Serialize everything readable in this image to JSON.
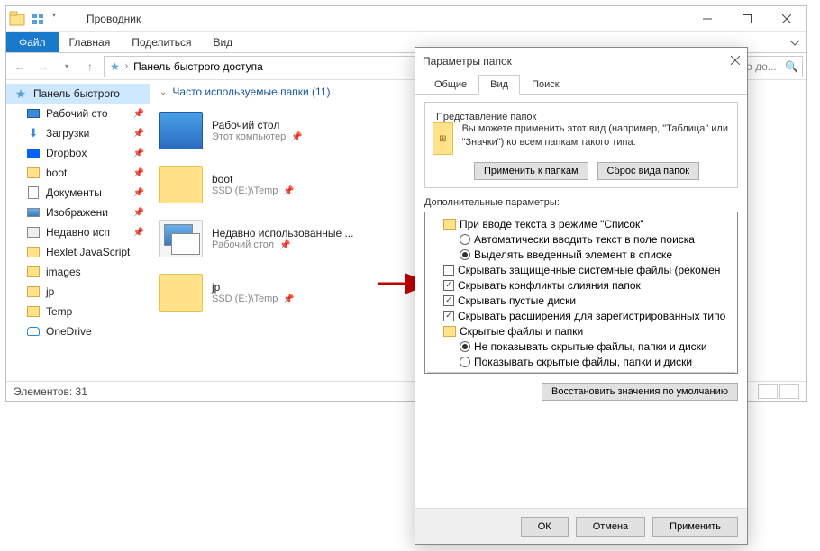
{
  "explorer": {
    "title": "Проводник",
    "tabs": {
      "file": "Файл",
      "home": "Главная",
      "share": "Поделиться",
      "view": "Вид"
    },
    "breadcrumb": "Панель быстрого доступа",
    "search_placeholder": "го до...",
    "group_header": "Часто используемые папки (11)",
    "status": "Элементов: 31",
    "sidebar": [
      {
        "label": "Панель быстрого",
        "type": "qa"
      },
      {
        "label": "Рабочий сто",
        "type": "desktop",
        "pinned": true
      },
      {
        "label": "Загрузки",
        "type": "download",
        "pinned": true
      },
      {
        "label": "Dropbox",
        "type": "dropbox",
        "pinned": true
      },
      {
        "label": "boot",
        "type": "folder",
        "pinned": true
      },
      {
        "label": "Документы",
        "type": "doc",
        "pinned": true
      },
      {
        "label": "Изображени",
        "type": "img",
        "pinned": true
      },
      {
        "label": "Недавно исп",
        "type": "recent",
        "pinned": true
      },
      {
        "label": "Hexlet JavaScript",
        "type": "folder"
      },
      {
        "label": "images",
        "type": "folder"
      },
      {
        "label": "jp",
        "type": "folder"
      },
      {
        "label": "Temp",
        "type": "folder"
      },
      {
        "label": "OneDrive",
        "type": "onedrive"
      }
    ],
    "files": [
      {
        "name": "Рабочий стол",
        "path": "Этот компьютер",
        "thumb": "desktop",
        "pinned": true
      },
      {
        "name": "boot",
        "path": "SSD (E:)\\Temp",
        "thumb": "folder",
        "pinned": true
      },
      {
        "name": "Недавно использованные ...",
        "path": "Рабочий стол",
        "thumb": "recent",
        "pinned": true
      },
      {
        "name": "jp",
        "path": "SSD (E:)\\Temp",
        "thumb": "folder",
        "pinned": true
      }
    ]
  },
  "dialog": {
    "title": "Параметры папок",
    "tabs": {
      "general": "Общие",
      "view": "Вид",
      "search": "Поиск"
    },
    "folder_views": {
      "legend": "Представление папок",
      "text": "Вы можете применить этот вид (например, \"Таблица\" или \"Значки\") ко всем папкам такого типа.",
      "apply": "Применить к папкам",
      "reset": "Сброс вида папок"
    },
    "advanced_label": "Дополнительные параметры:",
    "tree": [
      {
        "type": "folder",
        "level": 1,
        "label": "При вводе текста в режиме \"Список\""
      },
      {
        "type": "radio",
        "level": 2,
        "checked": false,
        "label": "Автоматически вводить текст в поле поиска"
      },
      {
        "type": "radio",
        "level": 2,
        "checked": true,
        "label": "Выделять введенный элемент в списке"
      },
      {
        "type": "check",
        "level": 1,
        "checked": false,
        "label": "Скрывать защищенные системные файлы (рекомен"
      },
      {
        "type": "check",
        "level": 1,
        "checked": true,
        "label": "Скрывать конфликты слияния папок"
      },
      {
        "type": "check",
        "level": 1,
        "checked": true,
        "label": "Скрывать пустые диски"
      },
      {
        "type": "check",
        "level": 1,
        "checked": true,
        "label": "Скрывать расширения для зарегистрированных типо"
      },
      {
        "type": "folder",
        "level": 1,
        "label": "Скрытые файлы и папки"
      },
      {
        "type": "radio",
        "level": 2,
        "checked": true,
        "label": "Не показывать скрытые файлы, папки и диски"
      },
      {
        "type": "radio",
        "level": 2,
        "checked": false,
        "label": "Показывать скрытые файлы, папки и диски"
      }
    ],
    "restore": "Восстановить значения по умолчанию",
    "buttons": {
      "ok": "ОК",
      "cancel": "Отмена",
      "apply": "Применить"
    }
  }
}
